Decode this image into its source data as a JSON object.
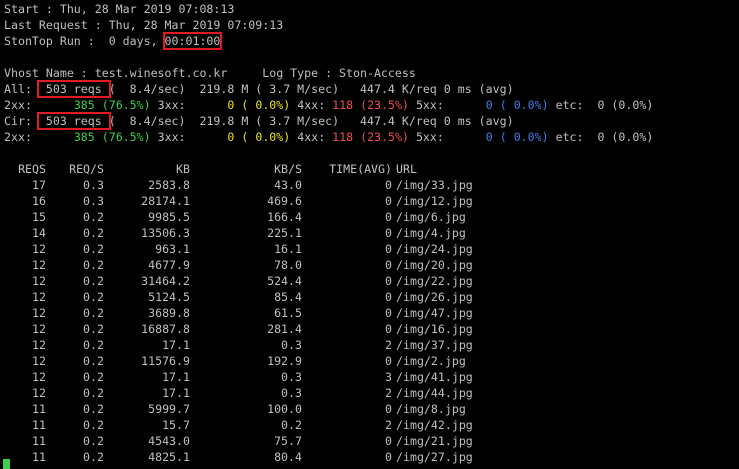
{
  "header": {
    "start": "Start : Thu, 28 Mar 2019 07:08:13",
    "last_request": "Last Request : Thu, 28 Mar 2019 07:09:13",
    "run_prefix": "StonTop Run :  0 days, ",
    "run_time": "00:01:00"
  },
  "vhost": {
    "line": "Vhost Name : test.winesoft.co.kr     Log Type : Ston-Access"
  },
  "all": {
    "label": "All: ",
    "reqs": " 503 reqs ",
    "rest": "(  8.4/sec)  219.8 M ( 3.7 M/sec)   447.4 K/req 0 ms (avg)",
    "codes": {
      "p2xx": "2xx:",
      "v2xx": "385",
      "r2xx": "(76.5%)",
      "p3xx": "3xx:",
      "v3xx": "0",
      "r3xx": "( 0.0%)",
      "p4xx": "4xx:",
      "v4xx": "118",
      "r4xx": "(23.5%)",
      "p5xx": "5xx:",
      "v5xx": "0",
      "r5xx": "( 0.0%)",
      "etc": "etc:  0 (0.0%)"
    }
  },
  "cir": {
    "label": "Cir: ",
    "reqs": " 503 reqs ",
    "rest": "(  8.4/sec)  219.8 M ( 3.7 M/sec)   447.4 K/req 0 ms (avg)",
    "codes": {
      "p2xx": "2xx:",
      "v2xx": "385",
      "r2xx": "(76.5%)",
      "p3xx": "3xx:",
      "v3xx": "0",
      "r3xx": "( 0.0%)",
      "p4xx": "4xx:",
      "v4xx": "118",
      "r4xx": "(23.5%)",
      "p5xx": "5xx:",
      "v5xx": "0",
      "r5xx": "( 0.0%)",
      "etc": "etc:  0 (0.0%)"
    }
  },
  "table": {
    "columns": [
      "REQS",
      "REQ/S",
      "KB",
      "KB/S",
      "TIME(AVG)",
      "URL"
    ],
    "rows": [
      [
        "17",
        "0.3",
        "2583.8",
        "43.0",
        "0",
        "/img/33.jpg"
      ],
      [
        "16",
        "0.3",
        "28174.1",
        "469.6",
        "0",
        "/img/12.jpg"
      ],
      [
        "15",
        "0.2",
        "9985.5",
        "166.4",
        "0",
        "/img/6.jpg"
      ],
      [
        "14",
        "0.2",
        "13506.3",
        "225.1",
        "0",
        "/img/4.jpg"
      ],
      [
        "12",
        "0.2",
        "963.1",
        "16.1",
        "0",
        "/img/24.jpg"
      ],
      [
        "12",
        "0.2",
        "4677.9",
        "78.0",
        "0",
        "/img/20.jpg"
      ],
      [
        "12",
        "0.2",
        "31464.2",
        "524.4",
        "0",
        "/img/22.jpg"
      ],
      [
        "12",
        "0.2",
        "5124.5",
        "85.4",
        "0",
        "/img/26.jpg"
      ],
      [
        "12",
        "0.2",
        "3689.8",
        "61.5",
        "0",
        "/img/47.jpg"
      ],
      [
        "12",
        "0.2",
        "16887.8",
        "281.4",
        "0",
        "/img/16.jpg"
      ],
      [
        "12",
        "0.2",
        "17.1",
        "0.3",
        "2",
        "/img/37.jpg"
      ],
      [
        "12",
        "0.2",
        "11576.9",
        "192.9",
        "0",
        "/img/2.jpg"
      ],
      [
        "12",
        "0.2",
        "17.1",
        "0.3",
        "3",
        "/img/41.jpg"
      ],
      [
        "12",
        "0.2",
        "17.1",
        "0.3",
        "2",
        "/img/44.jpg"
      ],
      [
        "11",
        "0.2",
        "5999.7",
        "100.0",
        "0",
        "/img/8.jpg"
      ],
      [
        "11",
        "0.2",
        "15.7",
        "0.2",
        "2",
        "/img/42.jpg"
      ],
      [
        "11",
        "0.2",
        "4543.0",
        "75.7",
        "0",
        "/img/21.jpg"
      ],
      [
        "11",
        "0.2",
        "4825.1",
        "80.4",
        "0",
        "/img/27.jpg"
      ]
    ]
  },
  "colors": {
    "background": "#000000",
    "text": "#c0c0c0",
    "highlight_box": "#e01b24",
    "code_2xx": "#3fd04a",
    "code_3xx": "#e8e020",
    "code_4xx": "#ef5050",
    "code_5xx": "#3f7fef",
    "cursor": "#3fd04a"
  }
}
